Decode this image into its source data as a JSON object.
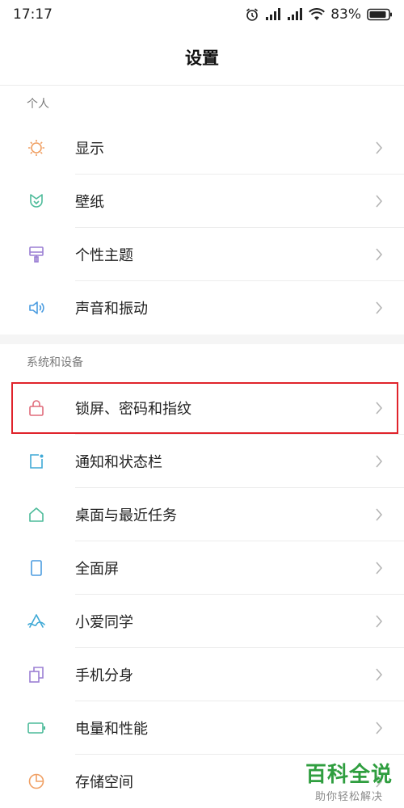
{
  "status_bar": {
    "time": "17:17",
    "battery": "83%"
  },
  "header": {
    "title": "设置"
  },
  "sections": [
    {
      "title": "个人",
      "items": [
        {
          "label": "显示",
          "icon": "sun-icon",
          "color": "#f0a064"
        },
        {
          "label": "壁纸",
          "icon": "tulip-icon",
          "color": "#4dbb9a"
        },
        {
          "label": "个性主题",
          "icon": "brush-icon",
          "color": "#9b7fd4"
        },
        {
          "label": "声音和振动",
          "icon": "speaker-icon",
          "color": "#4b9ce0"
        }
      ]
    },
    {
      "title": "系统和设备",
      "items": [
        {
          "label": "锁屏、密码和指纹",
          "icon": "lock-icon",
          "color": "#e06a7a"
        },
        {
          "label": "通知和状态栏",
          "icon": "notification-icon",
          "color": "#3fa9d6"
        },
        {
          "label": "桌面与最近任务",
          "icon": "home-icon",
          "color": "#4dbb9a"
        },
        {
          "label": "全面屏",
          "icon": "phone-icon",
          "color": "#4b9ce0"
        },
        {
          "label": "小爱同学",
          "icon": "xiaoai-icon",
          "color": "#3fa9d6"
        },
        {
          "label": "手机分身",
          "icon": "duplicate-icon",
          "color": "#9b7fd4"
        },
        {
          "label": "电量和性能",
          "icon": "battery-icon",
          "color": "#4dbb9a"
        },
        {
          "label": "存储空间",
          "icon": "pie-icon",
          "color": "#f0a064"
        }
      ]
    }
  ],
  "watermark": {
    "title": "百科全说",
    "subtitle": "助你轻松解决"
  }
}
